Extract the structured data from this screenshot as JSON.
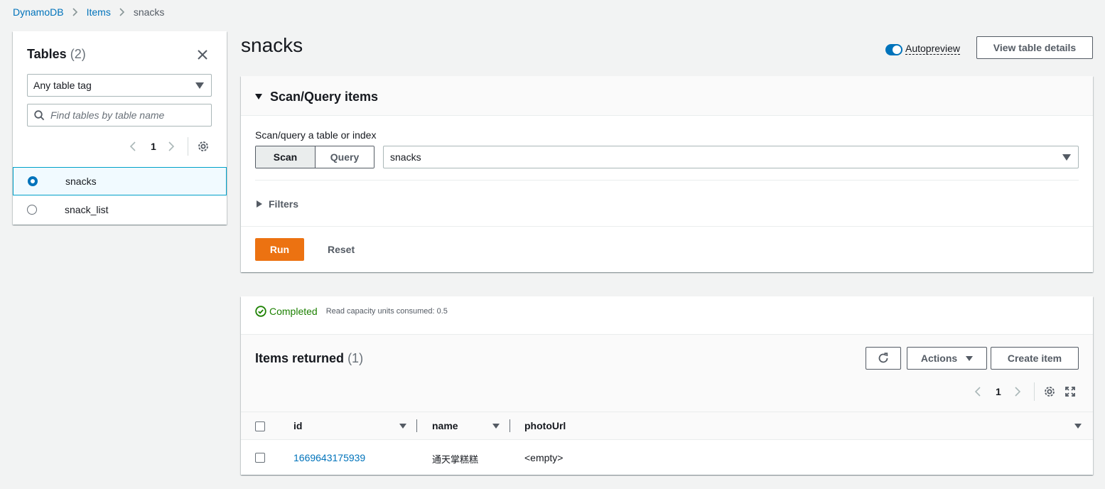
{
  "breadcrumb": {
    "items": [
      "DynamoDB",
      "Items"
    ],
    "current": "snacks"
  },
  "tables_panel": {
    "title": "Tables",
    "count": "(2)",
    "tag_filter": "Any table tag",
    "search_placeholder": "Find tables by table name",
    "page": "1",
    "tables": [
      {
        "name": "snacks",
        "selected": true
      },
      {
        "name": "snack_list",
        "selected": false
      }
    ]
  },
  "header": {
    "title": "snacks",
    "autopreview_label": "Autopreview",
    "view_details_label": "View table details"
  },
  "scan_query": {
    "title": "Scan/Query items",
    "subtitle": "Scan/query a table or index",
    "scan_label": "Scan",
    "query_label": "Query",
    "selected_target": "snacks",
    "filters_label": "Filters",
    "run_label": "Run",
    "reset_label": "Reset"
  },
  "results": {
    "status": "Completed",
    "capacity": "Read capacity units consumed: 0.5",
    "title": "Items returned",
    "count": "(1)",
    "actions_label": "Actions",
    "create_label": "Create item",
    "page": "1",
    "columns": [
      "id",
      "name",
      "photoUrl"
    ],
    "rows": [
      {
        "id": "1669643175939",
        "name": "通天掌糕糕",
        "photoUrl": "<empty>"
      }
    ]
  },
  "colors": {
    "link": "#0073bb",
    "primary": "#ec7211",
    "success": "#1d8102",
    "selected_border": "#00a1c9"
  }
}
